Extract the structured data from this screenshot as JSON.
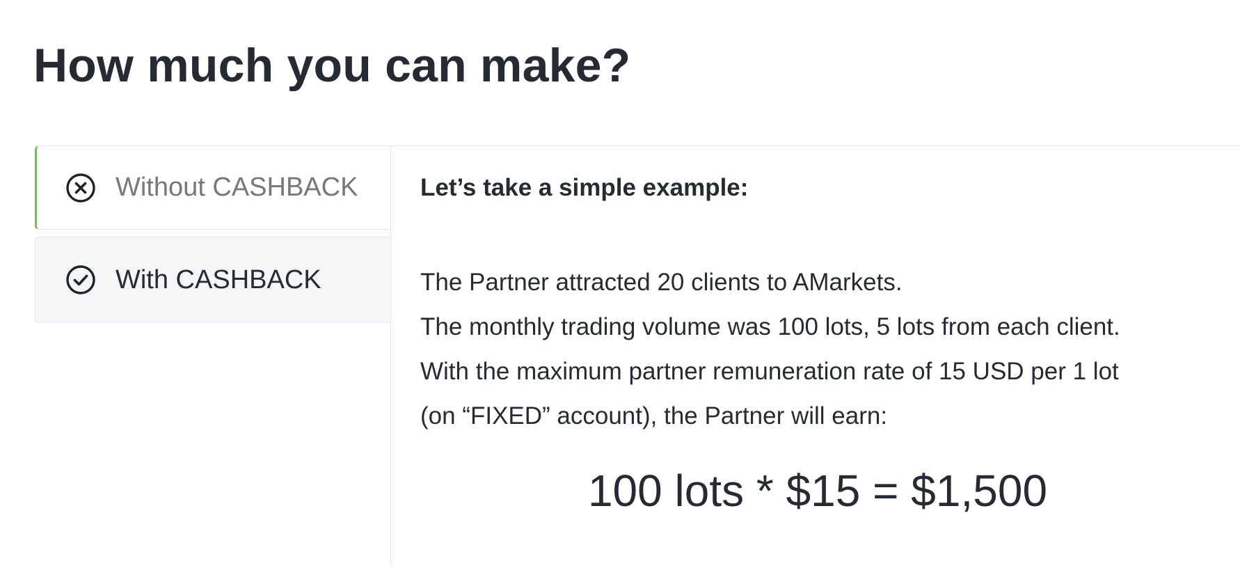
{
  "page": {
    "title": "How much you can make?"
  },
  "tabs": [
    {
      "label": "Without CASHBACK",
      "icon": "close-circle-icon",
      "active": true
    },
    {
      "label": "With CASHBACK",
      "icon": "check-circle-icon",
      "active": false
    }
  ],
  "panel": {
    "heading": "Let’s take a simple example:",
    "lines": [
      "The Partner attracted 20 clients to AMarkets.",
      "The monthly trading volume was 100 lots, 5 lots from each client.",
      "With the maximum partner remuneration rate of 15 USD per 1 lot",
      "(on “FIXED” account), the Partner will earn:"
    ],
    "formula": "100 lots * $15 = $1,500"
  },
  "colors": {
    "accent": "#7bb868",
    "text": "#262b33",
    "muted_text": "#75797e",
    "inactive_tab_bg": "#f5f6f7",
    "border": "#e6e9ec"
  }
}
